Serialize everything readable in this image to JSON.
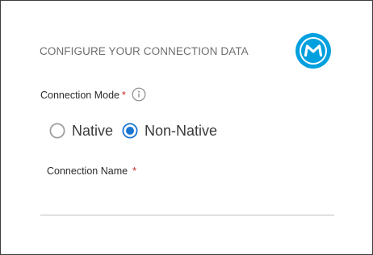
{
  "header": {
    "title": "CONFIGURE YOUR CONNECTION DATA",
    "logo_icon": "mulesoft-logo-icon",
    "brand_color": "#00a0df"
  },
  "connection_mode": {
    "label": "Connection Mode",
    "required_mark": "*",
    "info_icon": "info-circle-icon",
    "selected": "Non-Native",
    "options": [
      {
        "label": "Native",
        "checked": false
      },
      {
        "label": "Non-Native",
        "checked": true
      }
    ],
    "accent_color": "#1976d2"
  },
  "connection_name": {
    "label": "Connection Name",
    "required_mark": "*",
    "value": "",
    "placeholder": ""
  },
  "colors": {
    "required": "#c62828",
    "border": "#3c3c3c",
    "underline": "#bdbdbd"
  }
}
